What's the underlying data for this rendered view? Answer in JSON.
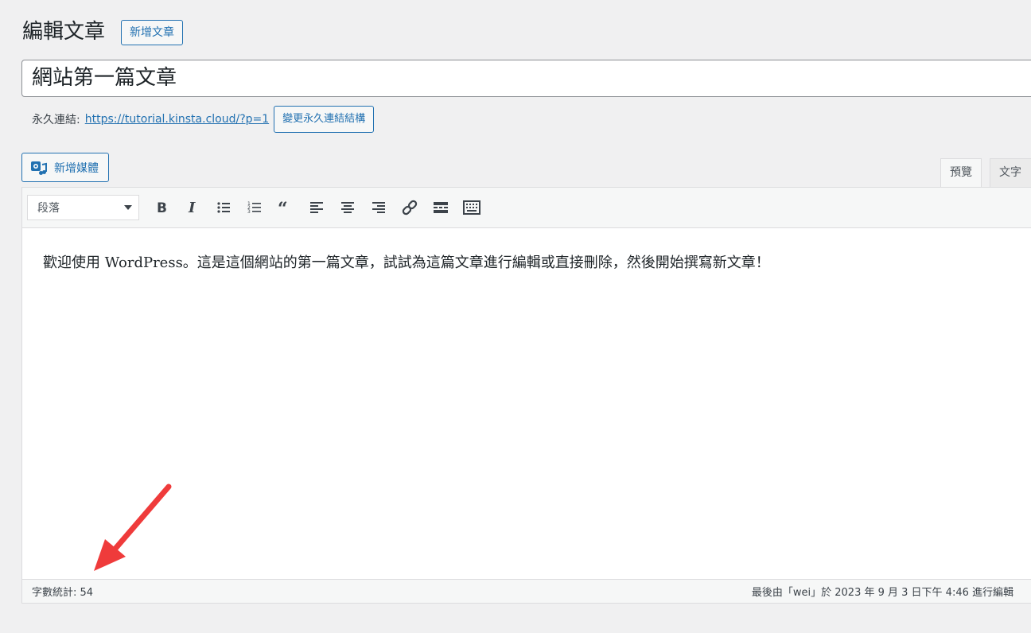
{
  "header": {
    "title": "編輯文章",
    "add_new_label": "新增文章"
  },
  "post": {
    "title": "網站第一篇文章"
  },
  "permalink": {
    "label": "永久連結:",
    "url": "https://tutorial.kinsta.cloud/?p=1",
    "change_button": "變更永久連結結構"
  },
  "media": {
    "add_media_label": "新增媒體",
    "icon": "add-media-icon"
  },
  "editor_tabs": {
    "visual": "預覽",
    "text": "文字"
  },
  "toolbar": {
    "format_selected": "段落",
    "buttons": [
      "bold-icon",
      "italic-icon",
      "bullet-list-icon",
      "numbered-list-icon",
      "blockquote-icon",
      "align-left-icon",
      "align-center-icon",
      "align-right-icon",
      "link-icon",
      "read-more-icon",
      "toolbar-toggle-icon"
    ]
  },
  "content": {
    "body": "歡迎使用 WordPress。這是這個網站的第一篇文章，試試為這篇文章進行編輯或直接刪除，然後開始撰寫新文章！"
  },
  "status": {
    "word_count": "字數統計: 54",
    "last_edited": "最後由「wei」於 2023 年 9 月 3 日下午 4:46 進行編輯"
  },
  "colors": {
    "accent": "#2271b1",
    "annotation_arrow": "#ef3b3b",
    "background": "#f0f0f1"
  }
}
